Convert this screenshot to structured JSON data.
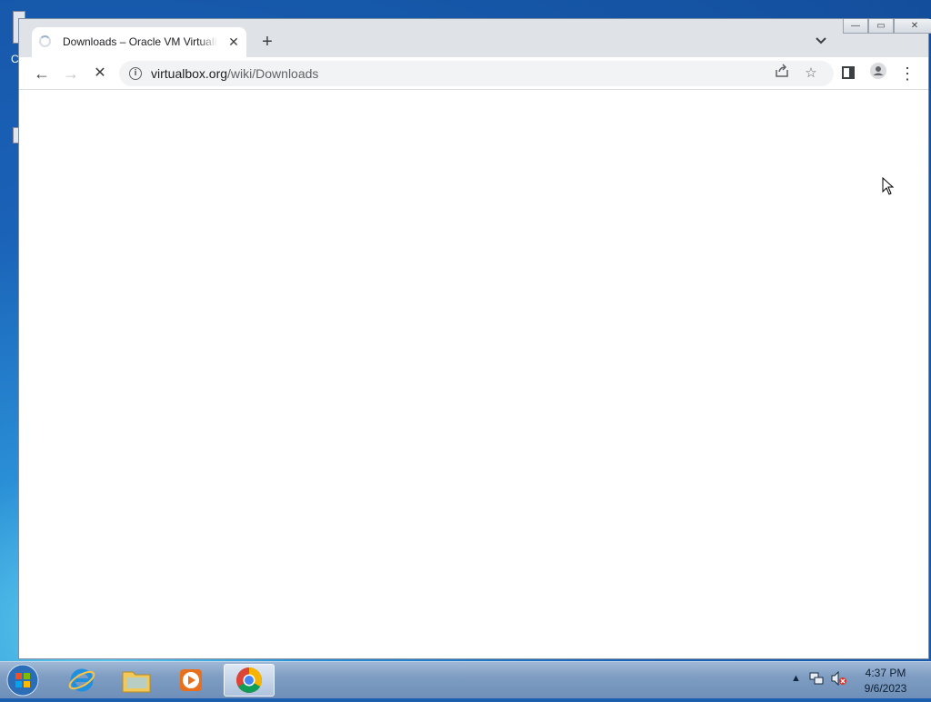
{
  "browser": {
    "tab": {
      "title": "Downloads – Oracle VM VirtualBox",
      "close_glyph": "✕"
    },
    "new_tab_glyph": "+",
    "tab_search_glyph": "⌄",
    "window_controls": {
      "minimize": "—",
      "maximize": "▭",
      "close": "✕"
    },
    "toolbar": {
      "back_glyph": "←",
      "forward_glyph": "→",
      "stop_glyph": "✕",
      "url_domain": "virtualbox.org",
      "url_path": "/wiki/Downloads",
      "menu_glyph": "⋮"
    }
  },
  "taskbar": {
    "apps": [
      "start-button",
      "internet-explorer",
      "file-explorer",
      "media-player",
      "google-chrome"
    ],
    "active_app": "google-chrome",
    "clock": {
      "time": "4:37 PM",
      "date": "9/6/2023"
    }
  },
  "desktop": {
    "icon_label_fragment": "C"
  }
}
